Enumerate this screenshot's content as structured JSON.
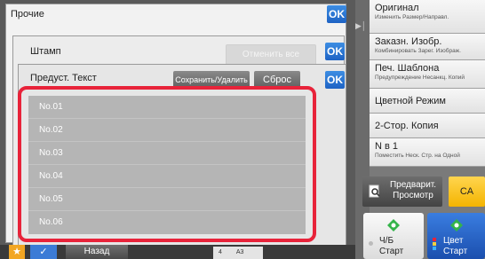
{
  "dialogs": {
    "misc_title": "Прочие",
    "stamp_title": "Штамп",
    "preset_title": "Предуст. Текст",
    "ok_label": "OK",
    "cancel_all_label": "Отменить все",
    "save_delete_label": "Сохранить/Удалить",
    "reset_label": "Сброс"
  },
  "preset_list": [
    "No.01",
    "No.02",
    "No.03",
    "No.04",
    "No.05",
    "No.06"
  ],
  "right_panel": {
    "original": {
      "title": "Оригинал",
      "sub": "Изменить Размер/Направл."
    },
    "custom_image": {
      "title": "Заказн. Изобр.",
      "sub": "Комбинировать Зарег. Изображ."
    },
    "print_template": {
      "title": "Печ. Шаблона",
      "sub": "Предупреждение Несанкц. Копий"
    },
    "color_mode": {
      "title": "Цветной Режим"
    },
    "duplex": {
      "title": "2-Стор. Копия"
    },
    "n_up": {
      "title": "N в 1",
      "sub": "Поместить Неск. Стр. на Одной"
    },
    "preview": "Предварит. Просмотр",
    "ca": "CA",
    "start_bw": [
      "Ч/Б",
      "Старт"
    ],
    "start_color": [
      "Цвет",
      "Старт"
    ]
  },
  "bottom": {
    "back": "Назад",
    "tray_num": "4",
    "paper": "A3"
  },
  "colors": {
    "highlight": "#e8233a",
    "ok_blue": "#1e63c4",
    "ca_yellow": "#f4b400",
    "start_green": "#35b44a"
  }
}
